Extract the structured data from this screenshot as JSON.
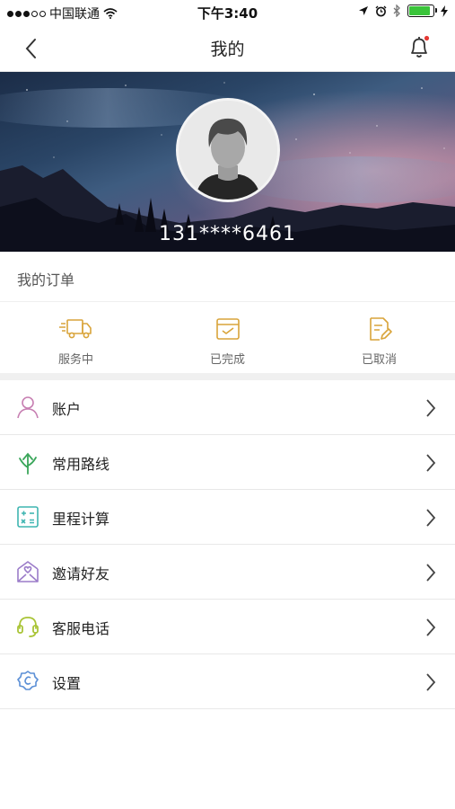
{
  "status_bar": {
    "carrier": "中国联通",
    "time": "下午3:40",
    "battery_percent": 90
  },
  "nav": {
    "title": "我的",
    "back_icon": "chevron-left-icon",
    "bell_icon": "bell-icon",
    "badge_color": "#e53935"
  },
  "profile": {
    "phone": "131****6461"
  },
  "orders": {
    "title": "我的订单",
    "items": [
      {
        "label": "服务中",
        "icon": "truck-icon"
      },
      {
        "label": "已完成",
        "icon": "calendar-check-icon"
      },
      {
        "label": "已取消",
        "icon": "document-edit-icon"
      }
    ],
    "icon_color": "#d9a43a"
  },
  "menu": [
    {
      "label": "账户",
      "icon": "user-icon",
      "color": "#c77fb2"
    },
    {
      "label": "常用路线",
      "icon": "route-arrow-icon",
      "color": "#3aa65a"
    },
    {
      "label": "里程计算",
      "icon": "calculator-icon",
      "color": "#3fb5b1"
    },
    {
      "label": "邀请好友",
      "icon": "invite-envelope-icon",
      "color": "#9b7cc9"
    },
    {
      "label": "客服电话",
      "icon": "headset-icon",
      "color": "#a9c436"
    },
    {
      "label": "设置",
      "icon": "settings-gear-icon",
      "color": "#5b8fd6"
    }
  ]
}
